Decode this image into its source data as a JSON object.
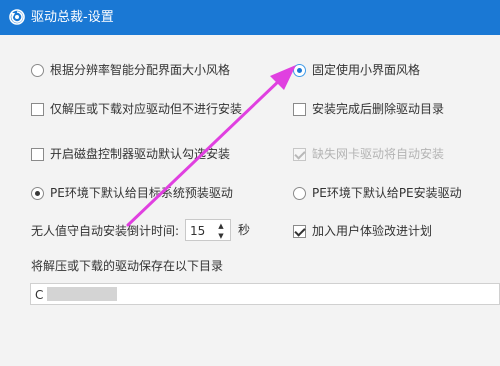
{
  "window": {
    "title": "驱动总裁-设置",
    "title_icon": "gear-refresh-icon"
  },
  "options": {
    "auto_style": "根据分辨率智能分配界面大小风格",
    "fixed_small": "固定使用小界面风格",
    "extract_only": "仅解压或下载对应驱动但不进行安装",
    "delete_after": "安装完成后删除驱动目录",
    "disk_controller": "开启磁盘控制器驱动默认勾选安装",
    "missing_nic": "缺失网卡驱动将自动安装",
    "pe_preinstall": "PE环境下默认给目标系统预装驱动",
    "pe_install": "PE环境下默认给PE安装驱动",
    "countdown_label": "无人值守自动安装倒计时间:",
    "countdown_value": "15",
    "countdown_unit": "秒",
    "join_plan": "加入用户体验改进计划",
    "save_dir_label": "将解压或下载的驱动保存在以下目录",
    "save_dir_value": "C"
  },
  "annotation": {
    "arrow_color": "#e040e0"
  }
}
